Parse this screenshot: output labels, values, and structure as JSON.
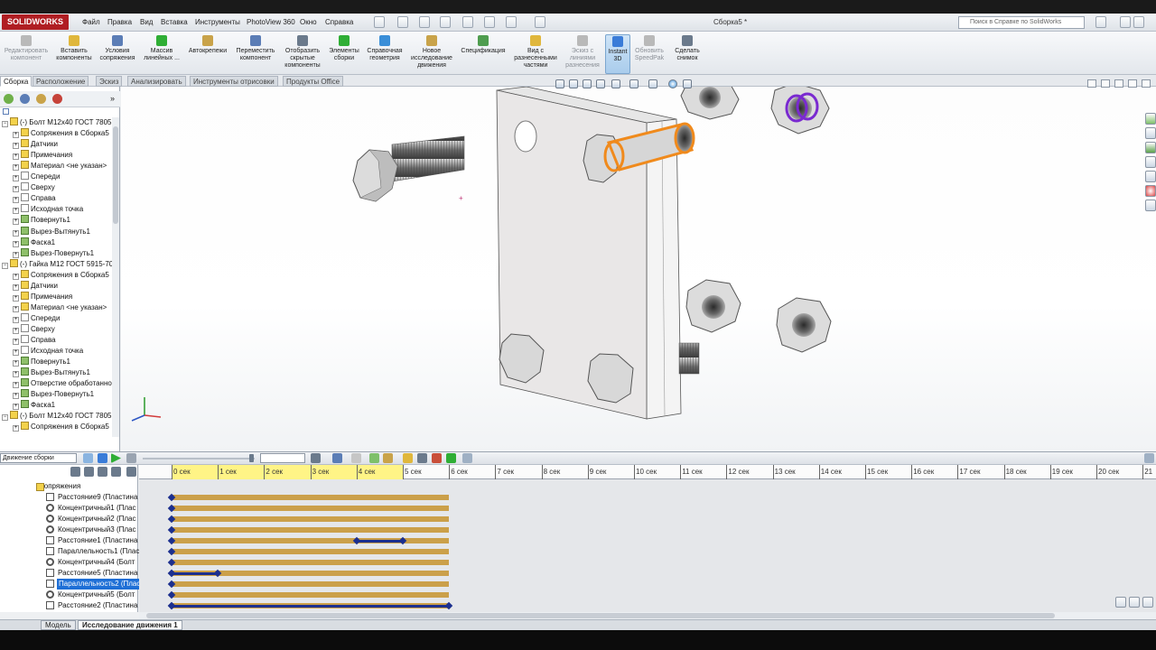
{
  "app": {
    "logo": "SOLIDWORKS",
    "doc_title": "Сборка5 *"
  },
  "menu": [
    "Файл",
    "Правка",
    "Вид",
    "Вставка",
    "Инструменты",
    "PhotoView 360",
    "Окно",
    "Справка"
  ],
  "search": {
    "placeholder": "Поиск в Справке по SolidWorks"
  },
  "ribbon": [
    {
      "label": "Редактировать компонент",
      "disabled": true
    },
    {
      "label": "Вставить компоненты"
    },
    {
      "label": "Условия сопряжения"
    },
    {
      "label": "Массив линейных ..."
    },
    {
      "label": "Автокрепежи"
    },
    {
      "label": "Переместить компонент"
    },
    {
      "label": "Отобразить скрытые компоненты"
    },
    {
      "label": "Элементы сборки"
    },
    {
      "label": "Справочная геометрия"
    },
    {
      "label": "Новое исследование движения"
    },
    {
      "label": "Спецификация"
    },
    {
      "label": "Вид с разнесенными частями"
    },
    {
      "label": "Эскиз с линиями разнесения",
      "disabled": true
    },
    {
      "label": "Instant 3D",
      "active": true
    },
    {
      "label": "Обновить SpeedPak",
      "disabled": true
    },
    {
      "label": "Сделать снимок"
    }
  ],
  "cm_tabs": [
    "Сборка",
    "Расположение",
    "Эскиз",
    "Анализировать",
    "Инструменты отрисовки",
    "Продукты Office"
  ],
  "tree": [
    {
      "label": "(-) Болт M12x40 ГОСТ 7805",
      "level": 0,
      "icon": "part"
    },
    {
      "label": "Сопряжения в Сборка5",
      "level": 1,
      "icon": "folder"
    },
    {
      "label": "Датчики",
      "level": 1,
      "icon": "folder"
    },
    {
      "label": "Примечания",
      "level": 1,
      "icon": "folder"
    },
    {
      "label": "Материал <не указан>",
      "level": 1,
      "icon": "material"
    },
    {
      "label": "Спереди",
      "level": 1,
      "icon": "plane"
    },
    {
      "label": "Сверху",
      "level": 1,
      "icon": "plane"
    },
    {
      "label": "Справа",
      "level": 1,
      "icon": "plane"
    },
    {
      "label": "Исходная точка",
      "level": 1,
      "icon": "origin"
    },
    {
      "label": "Повернуть1",
      "level": 1,
      "icon": "feature"
    },
    {
      "label": "Вырез-Вытянуть1",
      "level": 1,
      "icon": "feature"
    },
    {
      "label": "Фаска1",
      "level": 1,
      "icon": "feature"
    },
    {
      "label": "Вырез-Повернуть1",
      "level": 1,
      "icon": "feature"
    },
    {
      "label": "(-) Гайка M12 ГОСТ 5915-70",
      "level": 0,
      "icon": "part"
    },
    {
      "label": "Сопряжения в Сборка5",
      "level": 1,
      "icon": "folder"
    },
    {
      "label": "Датчики",
      "level": 1,
      "icon": "folder"
    },
    {
      "label": "Примечания",
      "level": 1,
      "icon": "folder"
    },
    {
      "label": "Материал <не указан>",
      "level": 1,
      "icon": "material"
    },
    {
      "label": "Спереди",
      "level": 1,
      "icon": "plane"
    },
    {
      "label": "Сверху",
      "level": 1,
      "icon": "plane"
    },
    {
      "label": "Справа",
      "level": 1,
      "icon": "plane"
    },
    {
      "label": "Исходная точка",
      "level": 1,
      "icon": "origin"
    },
    {
      "label": "Повернуть1",
      "level": 1,
      "icon": "feature"
    },
    {
      "label": "Вырез-Вытянуть1",
      "level": 1,
      "icon": "feature"
    },
    {
      "label": "Отверстие обработанное",
      "level": 1,
      "icon": "feature"
    },
    {
      "label": "Вырез-Повернуть1",
      "level": 1,
      "icon": "feature"
    },
    {
      "label": "Фаска1",
      "level": 1,
      "icon": "feature"
    },
    {
      "label": "(-) Болт M12x40 ГОСТ 7805",
      "level": 0,
      "icon": "part"
    },
    {
      "label": "Сопряжения в Сборка5",
      "level": 1,
      "icon": "folder"
    }
  ],
  "motion": {
    "study_type": "Движение сборки",
    "ruler": [
      "0 сек",
      "1 сек",
      "2 сек",
      "3 сек",
      "4 сек",
      "5 сек",
      "6 сек",
      "7 сек",
      "8 сек",
      "9 сек",
      "10 сек",
      "11 сек",
      "12 сек",
      "13 сек",
      "14 сек",
      "15 сек",
      "16 сек",
      "17 сек",
      "18 сек",
      "19 сек",
      "20 сек",
      "21"
    ],
    "rows": [
      {
        "label": "Сопряжения",
        "icon": "folder"
      },
      {
        "label": "Расстояние9 (Пластина",
        "icon": "distance",
        "segments": []
      },
      {
        "label": "Концентричный1 (Плас",
        "icon": "concentric",
        "segments": []
      },
      {
        "label": "Концентричный2 (Плас",
        "icon": "concentric",
        "segments": []
      },
      {
        "label": "Концентричный3 (Плас",
        "icon": "concentric",
        "segments": []
      },
      {
        "label": "Расстояние1 (Пластина",
        "icon": "distance",
        "segments": [
          [
            4,
            5
          ]
        ]
      },
      {
        "label": "Параллельность1 (Плас",
        "icon": "parallel",
        "segments": []
      },
      {
        "label": "Концентричный4 (Болт",
        "icon": "concentric",
        "segments": []
      },
      {
        "label": "Расстояние5 (Пластина",
        "icon": "distance",
        "segments": [
          [
            0,
            1
          ]
        ]
      },
      {
        "label": "Параллельность2 (Плас",
        "icon": "parallel",
        "selected": true,
        "segments": []
      },
      {
        "label": "Концентричный5 (Болт",
        "icon": "concentric",
        "segments": []
      },
      {
        "label": "Расстояние2 (Пластина",
        "icon": "distance",
        "segments": [
          [
            0,
            6
          ]
        ]
      }
    ],
    "duration_sec": 6
  },
  "bottom_tabs": [
    "Модель",
    "Исследование движения 1"
  ],
  "colors": {
    "ribbon_active": "#a9ccec",
    "timeline_bar": "#cba04a",
    "keyframe": "#1c2f8e",
    "selection_orange": "#f08a1c",
    "selection_purple": "#7a2ad0"
  }
}
